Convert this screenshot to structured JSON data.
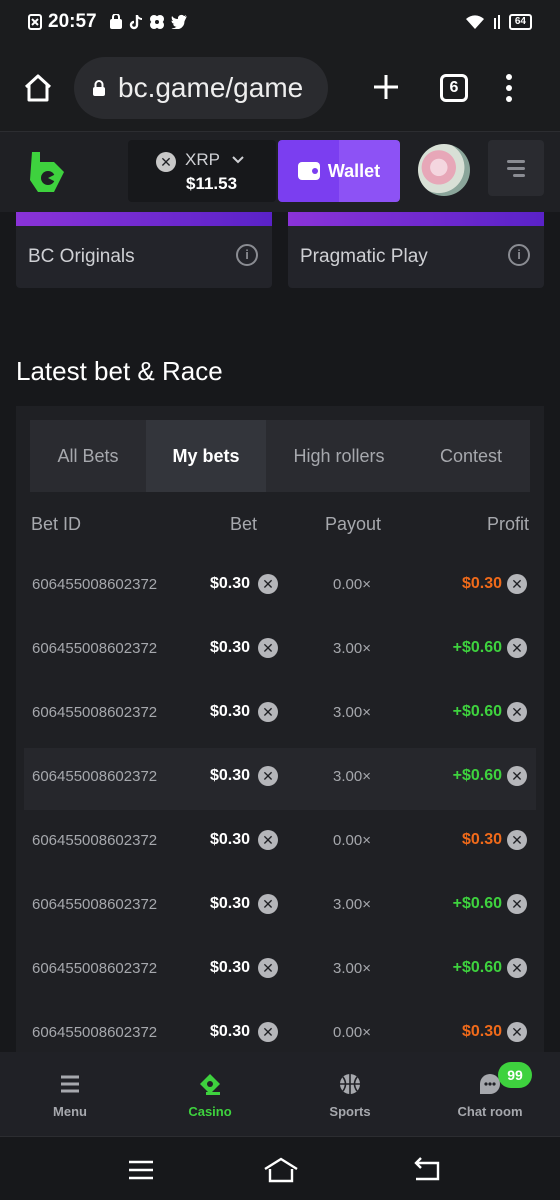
{
  "status_bar": {
    "time": "20:57",
    "notif_icons": [
      "close-box-icon",
      "shopping-bag-icon",
      "tiktok-icon",
      "pinwheel-icon",
      "twitter-icon"
    ],
    "battery": "64"
  },
  "browser": {
    "url": "bc.game/game",
    "tab_count": "6"
  },
  "header": {
    "currency": "XRP",
    "currency_symbol": "✕",
    "balance": "$11.53",
    "wallet_label": "Wallet"
  },
  "providers": [
    {
      "name": "BC Originals"
    },
    {
      "name": "Pragmatic Play"
    }
  ],
  "section_title": "Latest bet & Race",
  "tabs": [
    {
      "label": "All Bets"
    },
    {
      "label": "My bets"
    },
    {
      "label": "High rollers"
    },
    {
      "label": "Contest"
    }
  ],
  "columns": {
    "bet_id": "Bet ID",
    "bet": "Bet",
    "payout": "Payout",
    "profit": "Profit"
  },
  "bets": [
    {
      "id": "606455008602372",
      "bet": "$0.30",
      "payout": "0.00×",
      "profit": "$0.30",
      "result": "loss"
    },
    {
      "id": "606455008602372",
      "bet": "$0.30",
      "payout": "3.00×",
      "profit": "+$0.60",
      "result": "win"
    },
    {
      "id": "606455008602372",
      "bet": "$0.30",
      "payout": "3.00×",
      "profit": "+$0.60",
      "result": "win"
    },
    {
      "id": "606455008602372",
      "bet": "$0.30",
      "payout": "3.00×",
      "profit": "+$0.60",
      "result": "win"
    },
    {
      "id": "606455008602372",
      "bet": "$0.30",
      "payout": "0.00×",
      "profit": "$0.30",
      "result": "loss"
    },
    {
      "id": "606455008602372",
      "bet": "$0.30",
      "payout": "3.00×",
      "profit": "+$0.60",
      "result": "win"
    },
    {
      "id": "606455008602372",
      "bet": "$0.30",
      "payout": "3.00×",
      "profit": "+$0.60",
      "result": "win"
    },
    {
      "id": "606455008602372",
      "bet": "$0.30",
      "payout": "0.00×",
      "profit": "$0.30",
      "result": "loss"
    }
  ],
  "bottom_nav": [
    {
      "label": "Menu",
      "icon": "menu-icon"
    },
    {
      "label": "Casino",
      "icon": "casino-icon"
    },
    {
      "label": "Sports",
      "icon": "sports-ball-icon"
    },
    {
      "label": "Chat room",
      "icon": "chat-icon",
      "badge": "99"
    }
  ],
  "colors": {
    "accent_green": "#3ed23e",
    "loss_orange": "#f06a1a",
    "wallet_purple": "#7b3ef0",
    "background": "#17181b"
  }
}
